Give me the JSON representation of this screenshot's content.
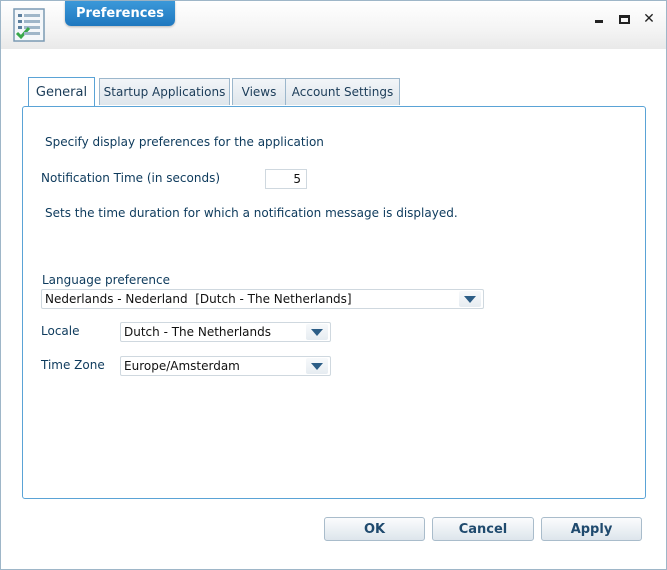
{
  "window": {
    "title": "Preferences",
    "controls": {
      "minimize": "minimize-icon",
      "maximize": "maximize-icon",
      "close": "close-icon"
    }
  },
  "tabs": [
    {
      "label": "General",
      "active": true
    },
    {
      "label": "Startup Applications",
      "active": false
    },
    {
      "label": "Views",
      "active": false
    },
    {
      "label": "Account Settings",
      "active": false
    }
  ],
  "general": {
    "intro": "Specify display preferences for the application",
    "notification_label": "Notification Time (in seconds)",
    "notification_value": "5",
    "notification_help": "Sets the time duration for which a notification message is displayed.",
    "language_label": "Language preference",
    "language_value": "Nederlands - Nederland  [Dutch - The Netherlands]",
    "locale_label": "Locale",
    "locale_value": "Dutch - The Netherlands",
    "timezone_label": "Time Zone",
    "timezone_value": "Europe/Amsterdam"
  },
  "buttons": {
    "ok": "OK",
    "cancel": "Cancel",
    "apply": "Apply"
  },
  "colors": {
    "accent": "#1f78bf",
    "text_blue": "#0d3a5c",
    "panel_border": "#5aa3d6"
  }
}
